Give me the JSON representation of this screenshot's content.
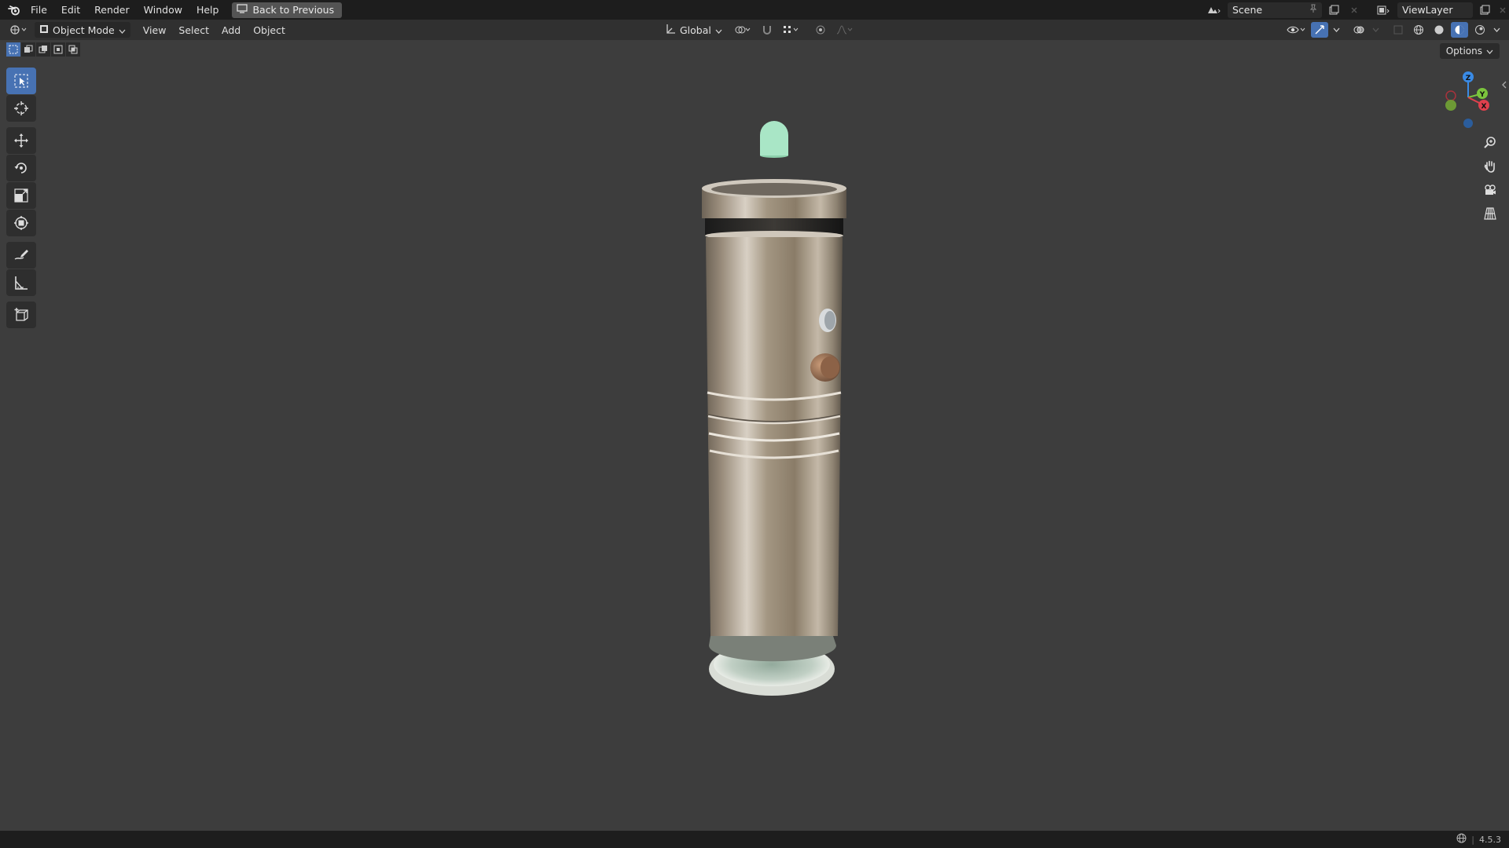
{
  "topbar": {
    "menus": [
      "File",
      "Edit",
      "Render",
      "Window",
      "Help"
    ],
    "back_label": "Back to Previous",
    "scene_name": "Scene",
    "view_layer": "ViewLayer"
  },
  "header": {
    "mode": "Object Mode",
    "menus": [
      "View",
      "Select",
      "Add",
      "Object"
    ],
    "orientation": "Global",
    "options_label": "Options"
  },
  "toolbar": {
    "tools": [
      "select-box",
      "cursor",
      "move",
      "rotate",
      "scale",
      "transform",
      "annotate",
      "measure",
      "add-cube"
    ],
    "active_tool": "select-box"
  },
  "gizmo": {
    "axes": [
      "X",
      "Y",
      "Z"
    ]
  },
  "status": {
    "version": "4.5.3"
  },
  "colors": {
    "accent": "#4772b3",
    "background": "#3d3d3d",
    "x_axis": "#e0404d",
    "y_axis": "#7bc53d",
    "z_axis": "#3a8be6"
  }
}
